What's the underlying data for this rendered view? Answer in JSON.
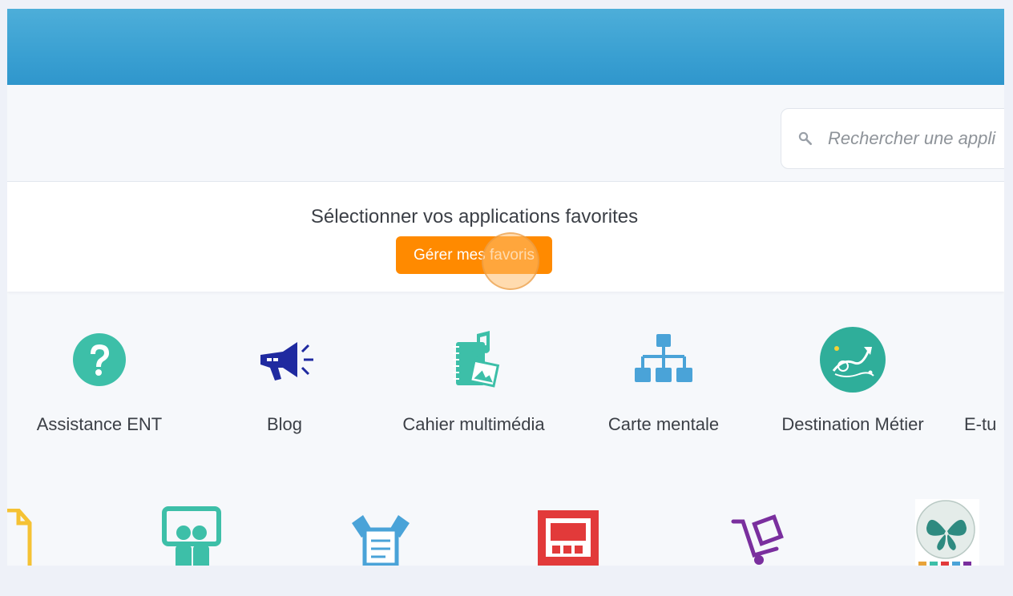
{
  "search": {
    "placeholder": "Rechercher une appli"
  },
  "favorites": {
    "title": "Sélectionner vos applications favorites",
    "button_label": "Gérer mes favoris"
  },
  "apps_row1": [
    {
      "label": "Assistance ENT",
      "icon": "question-icon",
      "color": "#3dbfa8"
    },
    {
      "label": "Blog",
      "icon": "megaphone-icon",
      "color": "#1f2aa0"
    },
    {
      "label": "Cahier multimédia",
      "icon": "multimedia-notebook-icon",
      "color": "#3dbfa8"
    },
    {
      "label": "Carte mentale",
      "icon": "org-chart-icon",
      "color": "#4aa3d8"
    },
    {
      "label": "Destination Métier",
      "icon": "career-destination-icon",
      "color": "#2fae9a"
    },
    {
      "label": "E-tu",
      "icon": "e-tu-icon",
      "color": "#3dbfa8"
    }
  ],
  "apps_row2": [
    {
      "icon": "document-icon",
      "color": "#f5c234"
    },
    {
      "icon": "users-board-icon",
      "color": "#3dbfa8"
    },
    {
      "icon": "survey-icon",
      "color": "#4aa3d8"
    },
    {
      "icon": "slideshow-icon",
      "color": "#e23a3a"
    },
    {
      "icon": "cart-icon",
      "color": "#7a2f9e"
    },
    {
      "icon": "pronote-icon",
      "color": "#2e8a80"
    }
  ],
  "colors": {
    "topbar": "#3aa0d2",
    "accent_button": "#ff8a00",
    "background": "#f6f8fb"
  }
}
